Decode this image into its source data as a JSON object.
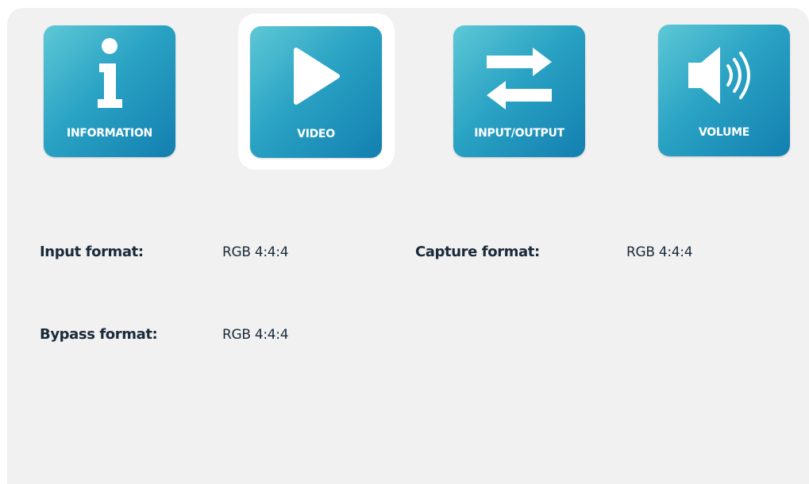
{
  "tabs": [
    {
      "label": "INFORMATION",
      "icon": "info-icon",
      "selected": false
    },
    {
      "label": "VIDEO",
      "icon": "play-icon",
      "selected": true
    },
    {
      "label": "INPUT/OUTPUT",
      "icon": "swap-arrows-icon",
      "selected": false
    },
    {
      "label": "VOLUME",
      "icon": "speaker-icon",
      "selected": false
    }
  ],
  "video": {
    "input_format_label": "Input format:",
    "input_format_value": "RGB 4:4:4",
    "capture_format_label": "Capture format:",
    "capture_format_value": "RGB 4:4:4",
    "bypass_format_label": "Bypass format:",
    "bypass_format_value": "RGB 4:4:4"
  },
  "colors": {
    "tile_gradient_light": "#5ec8d6",
    "tile_gradient_dark": "#137fb0",
    "panel_background": "#f1f1f1",
    "text": "#1a2a3a"
  }
}
